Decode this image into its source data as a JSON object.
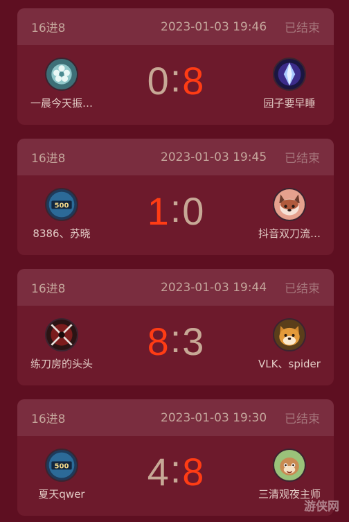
{
  "matches": [
    {
      "round": "16进8",
      "time": "2023-01-03 19:46",
      "status": "已结束",
      "left": {
        "name": "一晨今天振…",
        "score": "0",
        "avatar_icon": "blue-flower-icon"
      },
      "right": {
        "name": "园子要早睡",
        "score": "8",
        "avatar_icon": "purple-crystal-icon"
      },
      "winner": "right"
    },
    {
      "round": "16进8",
      "time": "2023-01-03 19:45",
      "status": "已结束",
      "left": {
        "name": "8386、苏晓",
        "score": "1",
        "avatar_icon": "500-badge-icon"
      },
      "right": {
        "name": "抖音双刀流…",
        "score": "0",
        "avatar_icon": "fox-avatar-icon"
      },
      "winner": "left"
    },
    {
      "round": "16进8",
      "time": "2023-01-03 19:44",
      "status": "已结束",
      "left": {
        "name": "练刀房的头头",
        "score": "8",
        "avatar_icon": "crossed-swords-icon"
      },
      "right": {
        "name": "VLK、spider",
        "score": "3",
        "avatar_icon": "shiba-dog-icon"
      },
      "winner": "left"
    },
    {
      "round": "16进8",
      "time": "2023-01-03 19:30",
      "status": "已结束",
      "left": {
        "name": "夏天qwer",
        "score": "4",
        "avatar_icon": "500-badge-icon"
      },
      "right": {
        "name": "三清观夜主师",
        "score": "8",
        "avatar_icon": "cartoon-face-icon"
      },
      "winner": "right"
    }
  ],
  "colors": {
    "winner_score": "#ff3c14",
    "loser_score": "#c7a896"
  },
  "watermark": "游侠网"
}
